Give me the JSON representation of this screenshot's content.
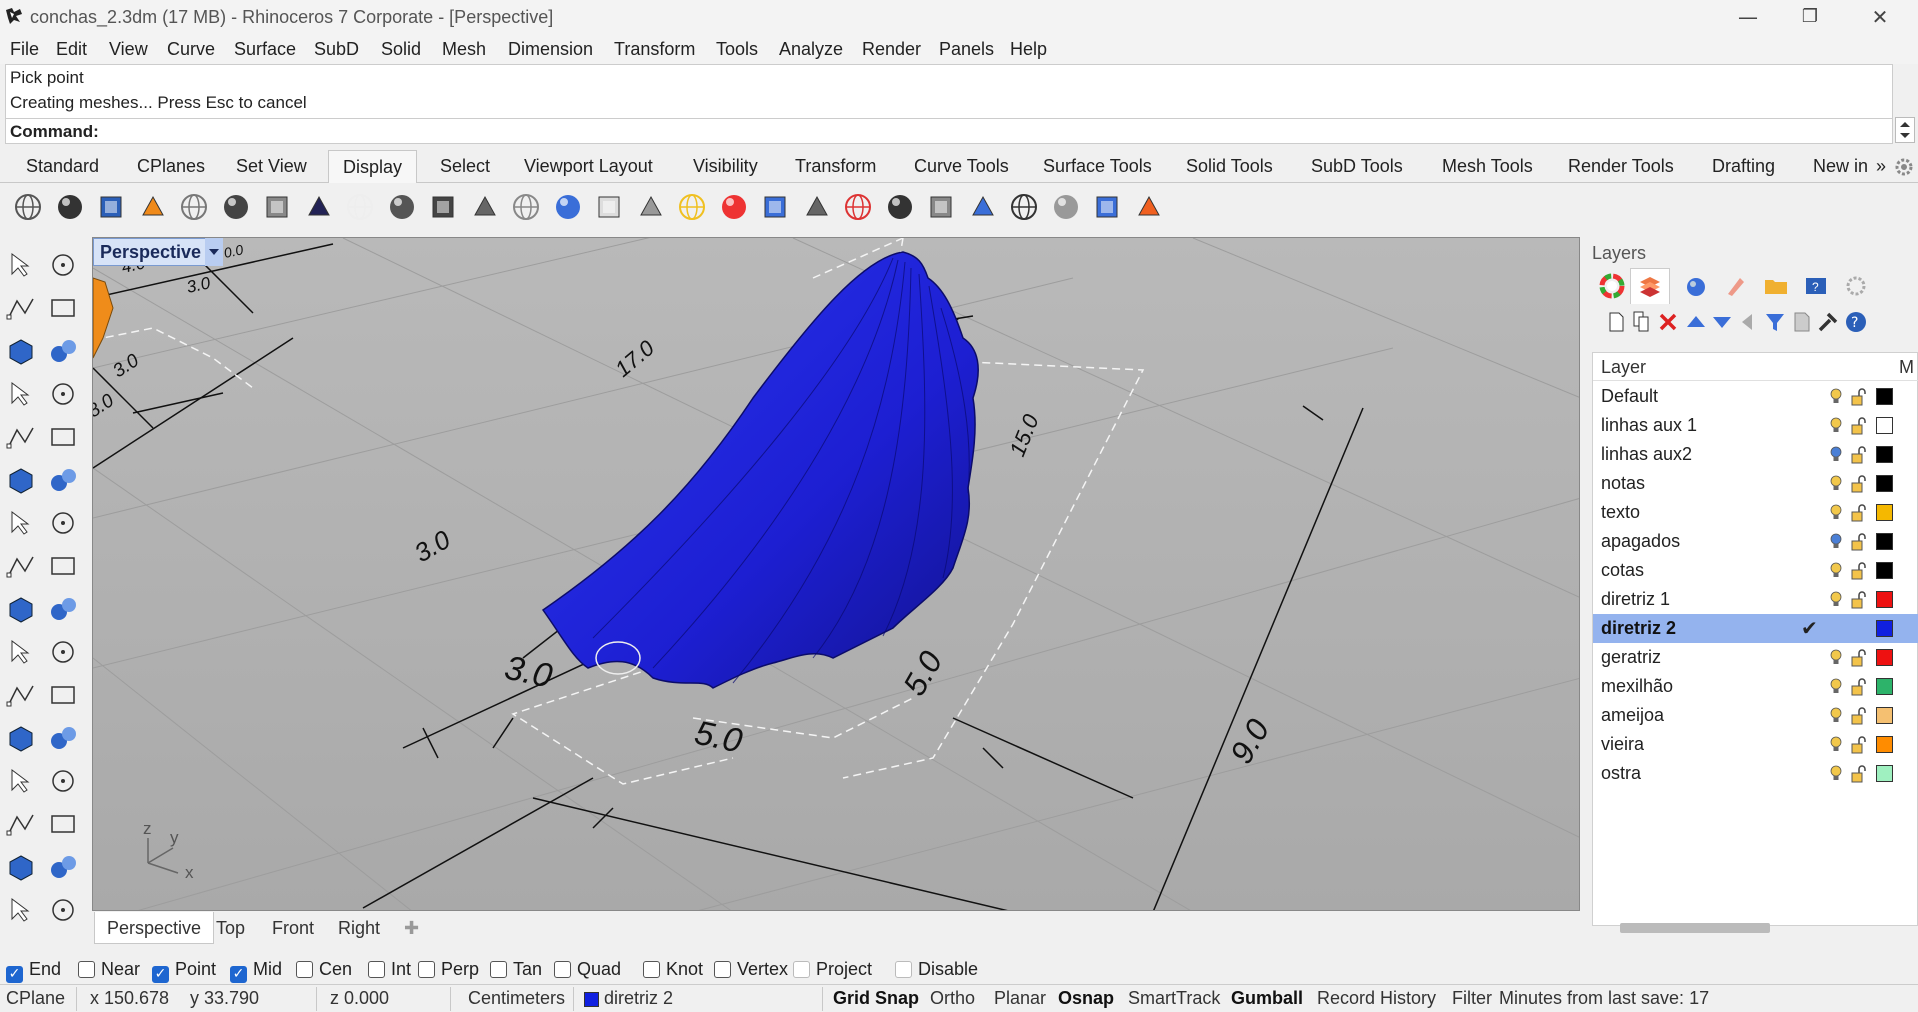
{
  "window": {
    "title": "conchas_2.3dm (17 MB) - Rhinoceros 7 Corporate - [Perspective]",
    "minimize": "—",
    "restore": "❐",
    "close": "✕"
  },
  "menu": [
    "File",
    "Edit",
    "View",
    "Curve",
    "Surface",
    "SubD",
    "Solid",
    "Mesh",
    "Dimension",
    "Transform",
    "Tools",
    "Analyze",
    "Render",
    "Panels",
    "Help"
  ],
  "command": {
    "history": [
      "Pick point",
      "Creating meshes... Press Esc to cancel"
    ],
    "prompt": "Command:"
  },
  "toolbar_tabs": [
    "Standard",
    "CPlanes",
    "Set View",
    "Display",
    "Select",
    "Viewport Layout",
    "Visibility",
    "Transform",
    "Curve Tools",
    "Surface Tools",
    "Solid Tools",
    "SubD Tools",
    "Mesh Tools",
    "Render Tools",
    "Drafting",
    "New in"
  ],
  "toolbar_tabs_active": "Display",
  "toolbar_more": "»",
  "display_icons": [
    "wireframe-icon",
    "shaded-icon",
    "rendered-icon",
    "ghosted-icon",
    "xray-icon",
    "technical-icon",
    "artistic-icon",
    "pen-icon",
    "arctic-icon",
    "raytraced-icon",
    "monochrome-icon",
    "pen2-icon",
    "toggle-icon",
    "zebra-icon",
    "env-map-icon",
    "draft-angle-icon",
    "curvature-icon",
    "emap-icon",
    "transparent-icon",
    "ground-plane-icon",
    "sun-icon",
    "spotlight-icon",
    "section-icon",
    "clipping-icon",
    "monitor-icon",
    "wire-cube-icon",
    "cube-color-icon",
    "color-grid-icon"
  ],
  "viewport": {
    "name": "Perspective",
    "dims": [
      "4.0",
      "3.0",
      "3.0",
      "8.0",
      "17.0",
      "15.0",
      "3.0",
      "3.0",
      "5.0",
      "5.0",
      "9.0",
      "0.0"
    ],
    "axis_labels": [
      "z",
      "y",
      "x"
    ]
  },
  "viewport_tabs": [
    "Perspective",
    "Top",
    "Front",
    "Right"
  ],
  "viewport_tabs_add": "✚",
  "layers": {
    "title": "Layers",
    "column": "Layer",
    "column2": "M",
    "rows": [
      {
        "name": "Default",
        "color": "#000000",
        "bulb": "#f2c84b"
      },
      {
        "name": "linhas aux 1",
        "color": "#ffffff",
        "bulb": "#f2c84b"
      },
      {
        "name": "linhas aux2",
        "color": "#000000",
        "bulb": "#4a7fd6"
      },
      {
        "name": "notas",
        "color": "#000000",
        "bulb": "#f2c84b"
      },
      {
        "name": "texto",
        "color": "#f5b800",
        "bulb": "#f2c84b"
      },
      {
        "name": "apagados",
        "color": "#000000",
        "bulb": "#4a7fd6"
      },
      {
        "name": "cotas",
        "color": "#000000",
        "bulb": "#f2c84b"
      },
      {
        "name": "diretriz 1",
        "color": "#ee1111",
        "bulb": "#f2c84b"
      },
      {
        "name": "diretriz 2",
        "color": "#1020e0",
        "bulb": "",
        "selected": true,
        "current": "✔"
      },
      {
        "name": "geratriz",
        "color": "#ee1111",
        "bulb": "#f2c84b"
      },
      {
        "name": "mexilhão",
        "color": "#2db36a",
        "bulb": "#f2c84b"
      },
      {
        "name": "ameijoa",
        "color": "#f5c071",
        "bulb": "#f2c84b"
      },
      {
        "name": "vieira",
        "color": "#ff8c00",
        "bulb": "#f2c84b"
      },
      {
        "name": "ostra",
        "color": "#9ff0c0",
        "bulb": "#f2c84b"
      }
    ]
  },
  "osnaps": [
    {
      "label": "End",
      "checked": true
    },
    {
      "label": "Near",
      "checked": false
    },
    {
      "label": "Point",
      "checked": true
    },
    {
      "label": "Mid",
      "checked": true
    },
    {
      "label": "Cen",
      "checked": false
    },
    {
      "label": "Int",
      "checked": false
    },
    {
      "label": "Perp",
      "checked": false
    },
    {
      "label": "Tan",
      "checked": false
    },
    {
      "label": "Quad",
      "checked": false
    },
    {
      "label": "Knot",
      "checked": false
    },
    {
      "label": "Vertex",
      "checked": false
    },
    {
      "label": "Project",
      "checked": false,
      "disabled": true
    },
    {
      "label": "Disable",
      "checked": false,
      "disabled": true
    }
  ],
  "status": {
    "cplane": "CPlane",
    "x": "x 150.678",
    "y": "y 33.790",
    "z": "z 0.000",
    "units": "Centimeters",
    "layer": "diretriz 2",
    "layer_color": "#1020e0",
    "grid_snap": "Grid Snap",
    "ortho": "Ortho",
    "planar": "Planar",
    "osnap": "Osnap",
    "smarttrack": "SmartTrack",
    "gumball": "Gumball",
    "record_history": "Record History",
    "filter": "Filter",
    "save": "Minutes from last save: 17"
  }
}
